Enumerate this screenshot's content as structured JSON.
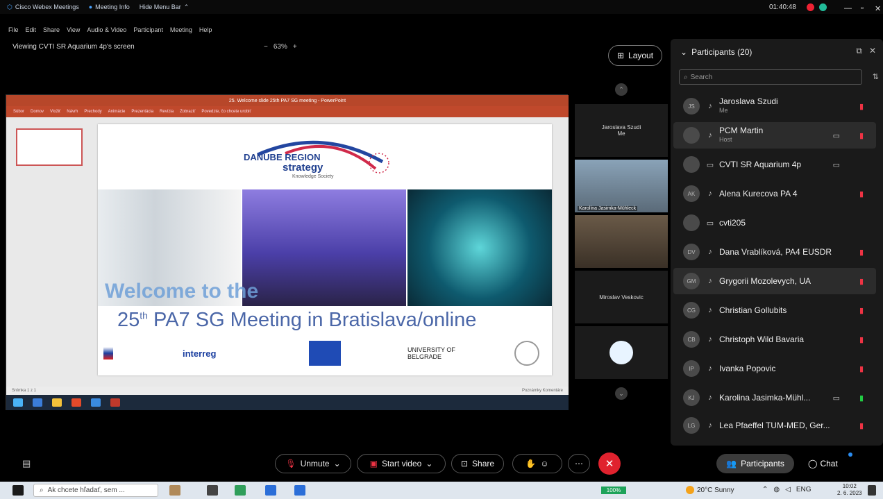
{
  "titlebar": {
    "app": "Cisco Webex Meetings",
    "meeting_info": "Meeting Info",
    "hide_menu": "Hide Menu Bar",
    "time": "01:40:48"
  },
  "menu": [
    "File",
    "Edit",
    "Share",
    "View",
    "Audio & Video",
    "Participant",
    "Meeting",
    "Help"
  ],
  "share": {
    "viewing": "Viewing CVTI SR Aquarium 4p's screen",
    "zoom_minus": "−",
    "zoom": "63%",
    "zoom_plus": "+"
  },
  "ppt": {
    "title": "25. Welcome slide 25th PA7 SG meeting - PowerPoint",
    "ribbon": [
      "Súbor",
      "Domov",
      "Vložiť",
      "Návrh",
      "Prechody",
      "Animácie",
      "Prezentácia",
      "Revízia",
      "Zobraziť",
      "Povedzte, čo chcete urobiť"
    ],
    "status_left": "Snímka 1 z 1",
    "status_right": "Poznámky  Komentáre"
  },
  "slide": {
    "logo_line1": "DANUBE REGION",
    "logo_line2": "strategy",
    "logo_line3": "Knowledge Society",
    "welcome": "Welcome to the",
    "meeting_pre": "25",
    "meeting_sup": "th",
    "meeting_rest": " PA7 SG Meeting in Bratislava/online",
    "logos": [
      "interreg",
      "UNIVERSITY OF BELGRADE"
    ]
  },
  "layout_label": "Layout",
  "tiles": [
    {
      "name": "Jaroslava Szudi",
      "sub": "Me"
    },
    {
      "name": "Karolína Jasimka-Mühleck"
    },
    {
      "name": ""
    },
    {
      "name": "Miroslav Veskovic"
    },
    {
      "name": ""
    }
  ],
  "panel": {
    "title": "Participants (20)",
    "search_placeholder": "Search"
  },
  "participants": [
    {
      "initials": "JS",
      "name": "Jaroslava Szudi",
      "sub": "Me",
      "icon": "♪",
      "mic": "muted"
    },
    {
      "initials": "",
      "name": "PCM Martin",
      "sub": "Host",
      "icon": "♪",
      "mic": "muted",
      "video": true
    },
    {
      "initials": "",
      "name": "CVTI SR Aquarium 4p",
      "sub": "",
      "icon": "▭",
      "mic": "",
      "video": true
    },
    {
      "initials": "AK",
      "name": "Alena Kurecova PA 4",
      "sub": "",
      "icon": "♪",
      "mic": "muted"
    },
    {
      "initials": "",
      "name": "cvti205",
      "sub": "",
      "icon": "▭",
      "mic": ""
    },
    {
      "initials": "DV",
      "name": "Dana Vrablíková, PA4 EUSDR",
      "sub": "",
      "icon": "♪",
      "mic": "muted"
    },
    {
      "initials": "GM",
      "name": "Grygorii Mozolevych, UA",
      "sub": "",
      "icon": "♪",
      "mic": "muted"
    },
    {
      "initials": "CG",
      "name": "Christian Gollubits",
      "sub": "",
      "icon": "♪",
      "mic": "muted"
    },
    {
      "initials": "CB",
      "name": "Christoph Wild Bavaria",
      "sub": "",
      "icon": "♪",
      "mic": "muted"
    },
    {
      "initials": "IP",
      "name": "Ivanka Popovic",
      "sub": "",
      "icon": "♪",
      "mic": "muted"
    },
    {
      "initials": "KJ",
      "name": "Karolina Jasimka-Mühl...",
      "sub": "",
      "icon": "♪",
      "mic": "on",
      "video": true
    },
    {
      "initials": "LG",
      "name": "Lea Pfaeffel TUM-MED, Ger...",
      "sub": "",
      "icon": "♪",
      "mic": "muted"
    }
  ],
  "controls": {
    "unmute": "Unmute",
    "start_video": "Start video",
    "share": "Share",
    "participants": "Participants",
    "chat": "Chat"
  },
  "taskbar": {
    "search": "Ak chcete hľadať, sem ...",
    "battery": "100%",
    "weather": "20°C  Sunny",
    "lang": "ENG",
    "time": "10:02",
    "date": "2. 6. 2023"
  },
  "colors": {
    "end": "#e0222e",
    "ppt": "#b7472a",
    "panel": "#1a1a1a"
  }
}
